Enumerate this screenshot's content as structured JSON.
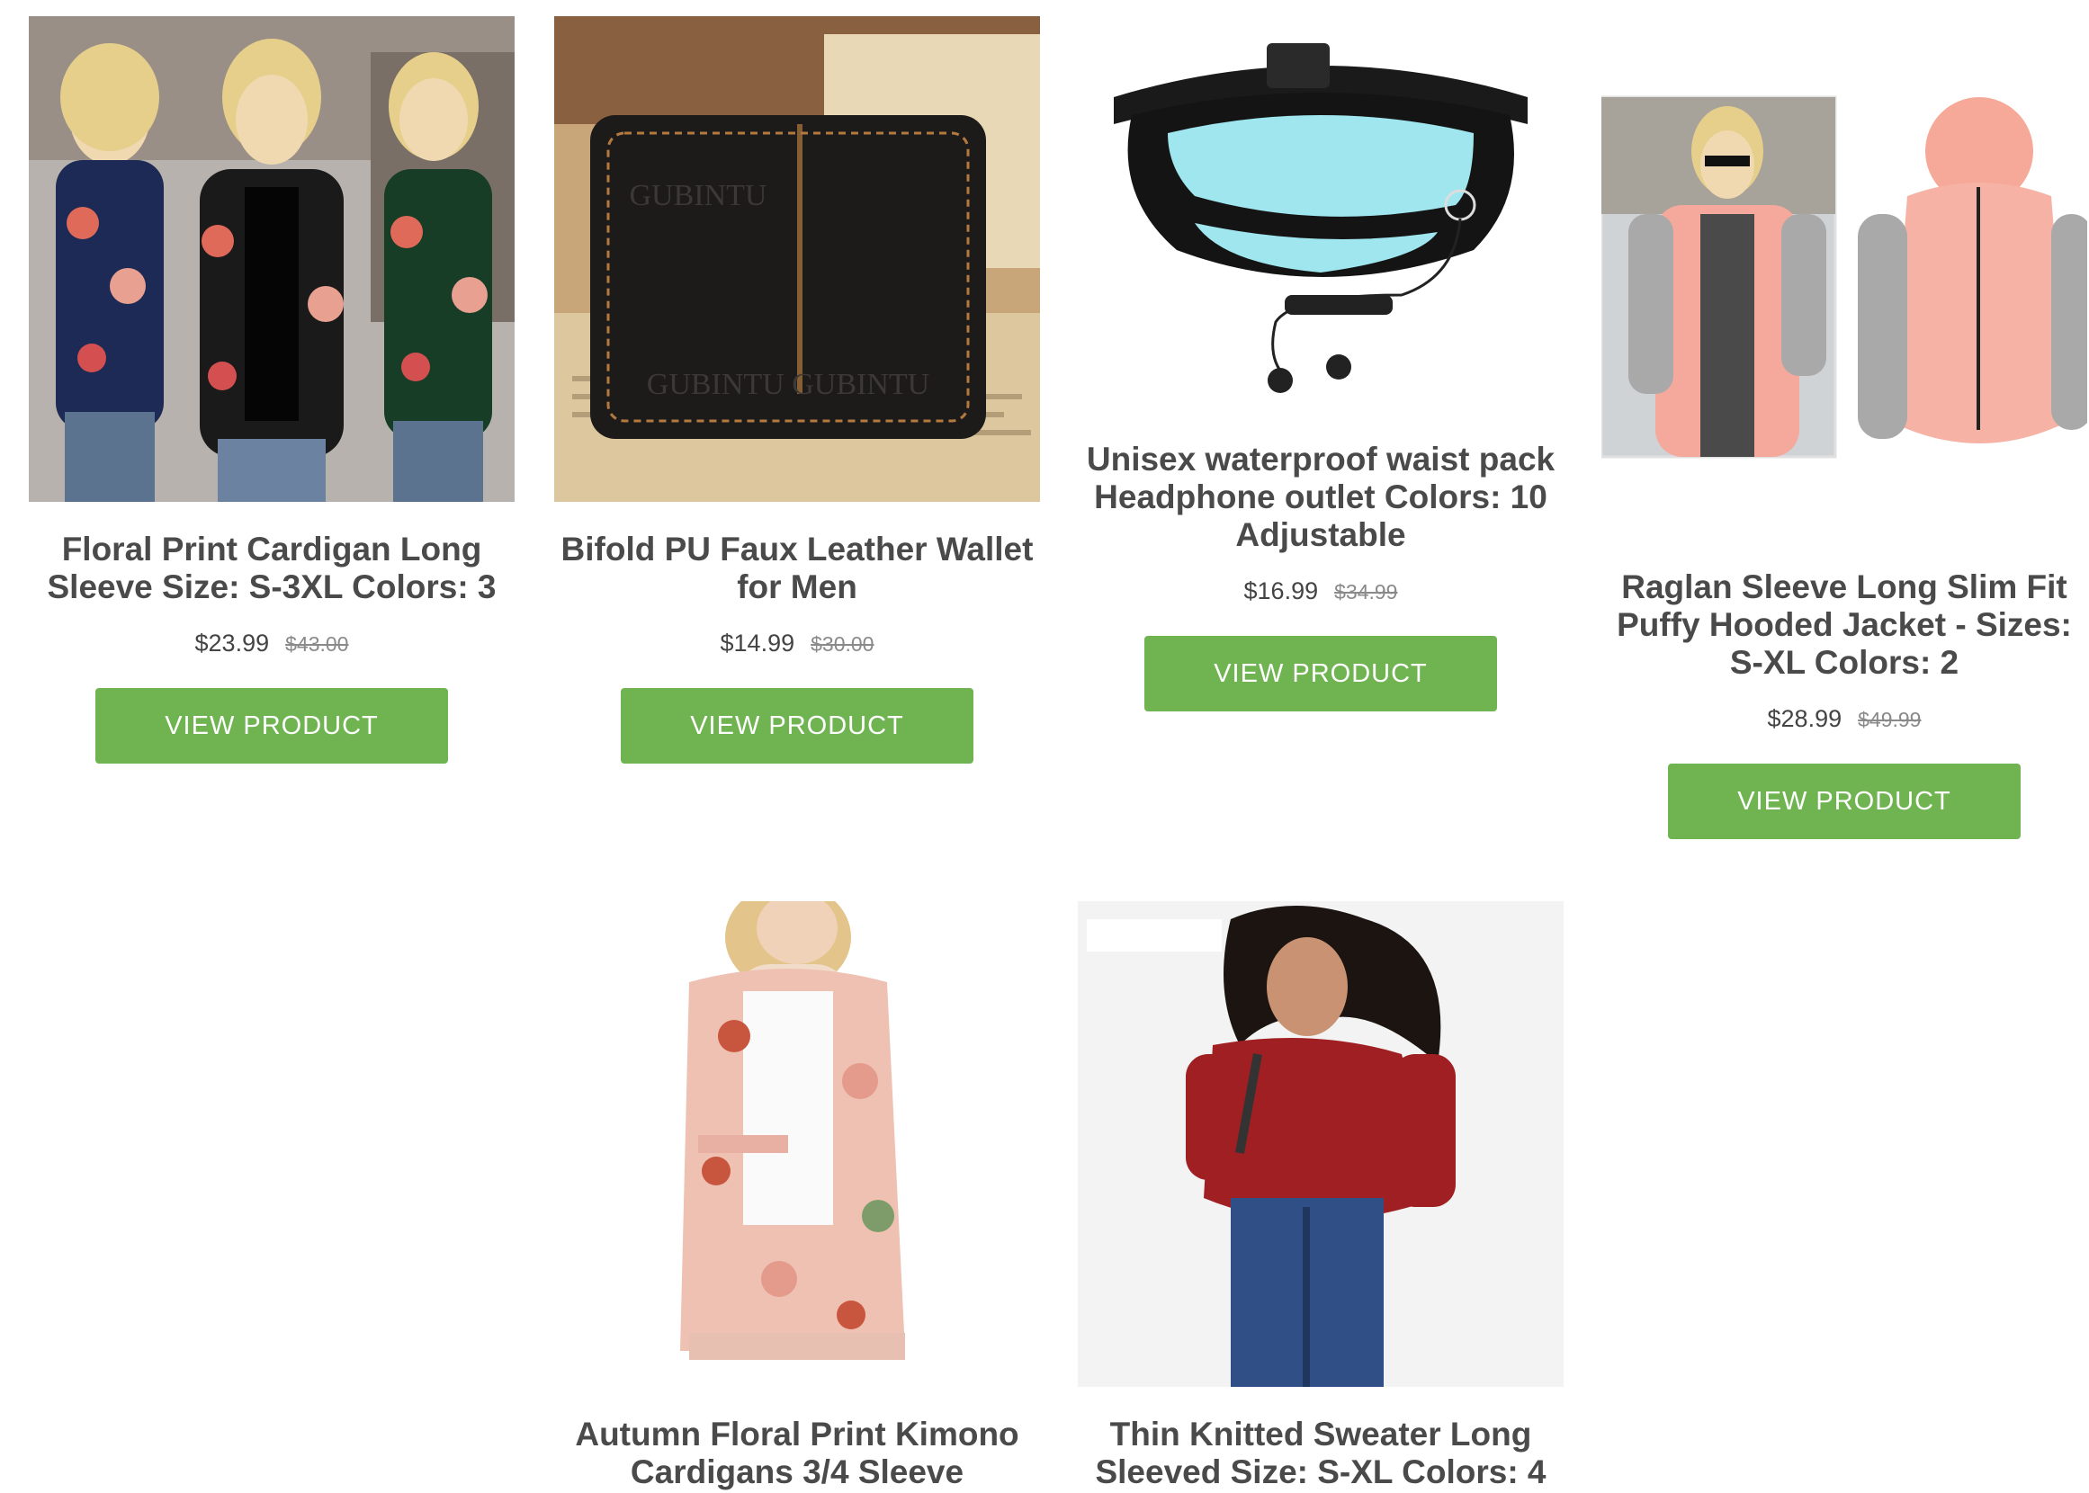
{
  "products": [
    {
      "title": "Floral Print Cardigan Long Sleeve Size: S-3XL Colors: 3",
      "price": "$23.99",
      "old_price": "$43.00",
      "button": "VIEW PRODUCT"
    },
    {
      "title": "Bifold PU Faux Leather Wallet for Men",
      "price": "$14.99",
      "old_price": "$30.00",
      "button": "VIEW PRODUCT",
      "image_text": [
        "GUBINTU",
        "GUBINTU GUBINTU"
      ]
    },
    {
      "title": "Unisex waterproof waist pack Headphone outlet Colors: 10 Adjustable",
      "price": "$16.99",
      "old_price": "$34.99",
      "button": "VIEW PRODUCT"
    },
    {
      "title": "Raglan Sleeve Long Slim Fit Puffy Hooded Jacket - Sizes: S-XL Colors: 2",
      "price": "$28.99",
      "old_price": "$49.99",
      "button": "VIEW PRODUCT"
    },
    {
      "title": "Autumn Floral Print Kimono Cardigans 3/4 Sleeve"
    },
    {
      "title": "Thin Knitted Sweater Long Sleeved Size: S-XL Colors: 4"
    }
  ],
  "colors": {
    "button": "#70b452",
    "title": "#4a4a4a",
    "old_price": "#8a8a8a"
  }
}
